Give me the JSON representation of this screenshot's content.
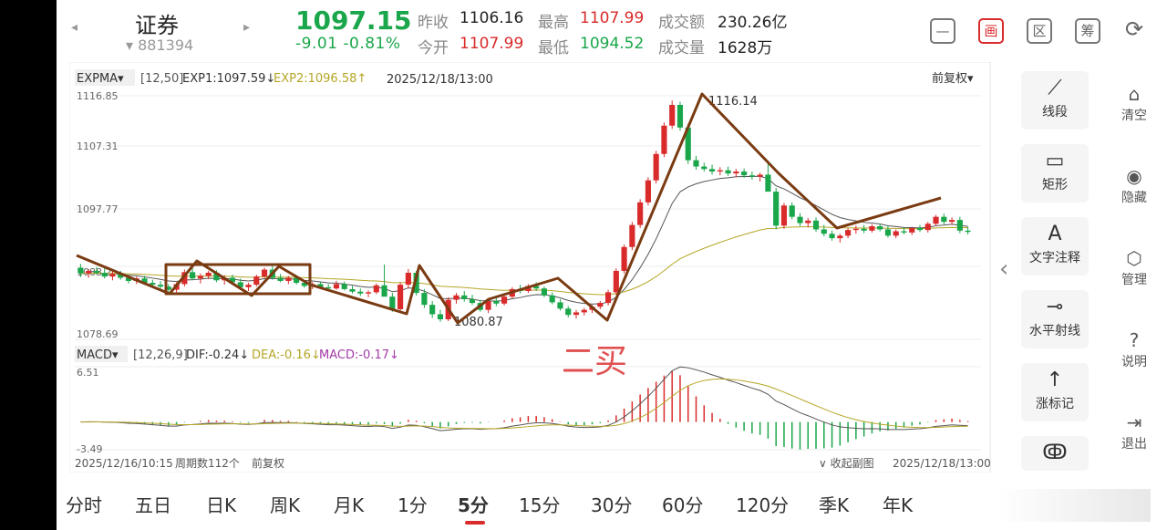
{
  "header": {
    "prev_label": "◂",
    "next_label": "▸",
    "title": "证券",
    "code": "▾ 881394",
    "price": "1097.15",
    "change": "-9.01  -0.81%",
    "stats": [
      {
        "label": "昨收",
        "value": "1106.16"
      },
      {
        "label": "今开",
        "value": "1107.99"
      },
      {
        "label": "最高",
        "value": "1107.99"
      },
      {
        "label": "最低",
        "value": "1094.52"
      },
      {
        "label": "成交额",
        "value": "230.26亿"
      },
      {
        "label": "成交量",
        "value": "1628万"
      }
    ],
    "tool_icons": [
      "minus-box-icon",
      "draw-icon",
      "zone-icon",
      "chip-icon",
      "rotate-screen-icon"
    ],
    "tool_glyphs": [
      "—",
      "画",
      "区",
      "筹",
      "⟳"
    ]
  },
  "chart": {
    "indicator_name": "EXPMA▾",
    "params": "[12,50]",
    "exp1": "EXP1:1097.59↓",
    "exp2": "EXP2:1096.58↑",
    "datetime": "2025/12/18/13:00",
    "adjust": "前复权▾",
    "price_labels": [
      "1116.85",
      "1107.31",
      "1097.77",
      "1088.2",
      "1078.69"
    ],
    "high_annotation": "1116.14",
    "low_annotation": "1080.87",
    "annotation_text": "二买",
    "macd_name": "MACD▾",
    "macd_params": "[12,26,9]",
    "dif": "DIF:-0.24↓",
    "dea": "DEA:-0.16↓",
    "macd": "MACD:-0.17↓",
    "macd_top": "6.51",
    "macd_bottom": "-3.49",
    "start_date": "2025/12/16/10:15",
    "period_count": "周期数112个",
    "adjust_small": "前复权",
    "collapse_label": "∨ 收起副图",
    "end_date": "2025/12/18/13:00"
  },
  "colors": {
    "up": "#d92b2b",
    "down": "#1aa64a",
    "exp1_line": "#555555",
    "exp2_line": "#b5a626",
    "draw_line": "#7a3b12",
    "macd_purple": "#a23aa8"
  },
  "tool_panel": [
    {
      "icon": "segment-icon",
      "glyph": "⟋",
      "label": "线段"
    },
    {
      "icon": "rectangle-icon",
      "glyph": "▭",
      "label": "矩形"
    },
    {
      "icon": "text-annotation-icon",
      "glyph": "A",
      "label": "文字注释"
    },
    {
      "icon": "horizontal-ray-icon",
      "glyph": "⊸",
      "label": "水平射线"
    },
    {
      "icon": "rise-marker-icon",
      "glyph": "↑",
      "label": "涨标记"
    },
    {
      "icon": "wave-icon",
      "glyph": "ↂ",
      "label": ""
    }
  ],
  "right_column": [
    {
      "icon": "clear-icon",
      "glyph": "⌂",
      "label": "清空"
    },
    {
      "icon": "eye-icon",
      "glyph": "◉",
      "label": "隐藏"
    },
    {
      "icon": "gear-icon",
      "glyph": "⬡",
      "label": "管理"
    },
    {
      "icon": "help-icon",
      "glyph": "?",
      "label": "说明"
    },
    {
      "icon": "exit-icon",
      "glyph": "⇥",
      "label": "退出"
    }
  ],
  "collapse_arrow": "‹",
  "tabs": [
    "分时",
    "五日",
    "日K",
    "周K",
    "月K",
    "1分",
    "5分",
    "15分",
    "30分",
    "60分",
    "120分",
    "季K",
    "年K"
  ],
  "active_tab": "5分",
  "tabs_more_icon": "more-icon",
  "chart_data": {
    "type": "candlestick",
    "ylim": [
      1078.69,
      1116.85
    ],
    "candles": [
      [
        1089.5,
        1090.1,
        1088.0,
        1088.6
      ],
      [
        1088.6,
        1089.3,
        1087.9,
        1089.0
      ],
      [
        1089.0,
        1089.6,
        1088.4,
        1088.7
      ],
      [
        1088.7,
        1089.5,
        1087.8,
        1088.1
      ],
      [
        1088.1,
        1088.9,
        1087.5,
        1088.5
      ],
      [
        1088.5,
        1089.0,
        1087.6,
        1087.9
      ],
      [
        1087.9,
        1088.3,
        1087.0,
        1087.4
      ],
      [
        1087.4,
        1088.1,
        1086.9,
        1087.8
      ],
      [
        1087.8,
        1088.2,
        1086.8,
        1087.1
      ],
      [
        1087.1,
        1087.6,
        1086.4,
        1086.8
      ],
      [
        1086.8,
        1087.4,
        1086.2,
        1086.5
      ],
      [
        1086.5,
        1086.9,
        1085.7,
        1086.0
      ],
      [
        1086.0,
        1087.2,
        1085.6,
        1086.9
      ],
      [
        1086.9,
        1089.2,
        1086.5,
        1088.8
      ],
      [
        1088.8,
        1089.4,
        1087.5,
        1087.8
      ],
      [
        1087.8,
        1088.6,
        1087.0,
        1088.2
      ],
      [
        1088.2,
        1089.0,
        1087.7,
        1088.7
      ],
      [
        1088.7,
        1089.1,
        1087.2,
        1087.5
      ],
      [
        1087.5,
        1088.3,
        1086.8,
        1087.9
      ],
      [
        1087.9,
        1088.4,
        1086.9,
        1087.2
      ],
      [
        1087.2,
        1087.8,
        1086.1,
        1086.4
      ],
      [
        1086.4,
        1087.1,
        1085.8,
        1086.8
      ],
      [
        1086.8,
        1088.4,
        1086.5,
        1088.1
      ],
      [
        1088.1,
        1089.5,
        1087.9,
        1089.2
      ],
      [
        1089.2,
        1089.8,
        1087.6,
        1087.9
      ],
      [
        1087.9,
        1088.5,
        1087.2,
        1087.4
      ],
      [
        1087.4,
        1088.2,
        1086.9,
        1087.9
      ],
      [
        1087.9,
        1088.3,
        1086.8,
        1087.1
      ],
      [
        1087.1,
        1087.5,
        1086.3,
        1086.6
      ],
      [
        1086.6,
        1087.2,
        1086.1,
        1086.9
      ],
      [
        1086.9,
        1087.3,
        1086.2,
        1086.4
      ],
      [
        1086.4,
        1086.9,
        1085.9,
        1086.2
      ],
      [
        1086.2,
        1087.4,
        1086.0,
        1086.9
      ],
      [
        1086.9,
        1087.3,
        1085.9,
        1086.1
      ],
      [
        1086.1,
        1086.6,
        1085.4,
        1085.7
      ],
      [
        1085.7,
        1086.2,
        1085.0,
        1085.4
      ],
      [
        1085.4,
        1085.9,
        1084.8,
        1085.6
      ],
      [
        1085.6,
        1087.0,
        1085.3,
        1086.7
      ],
      [
        1086.7,
        1090.0,
        1085.5,
        1084.9
      ],
      [
        1084.9,
        1085.5,
        1082.5,
        1082.9
      ],
      [
        1082.9,
        1087.2,
        1082.5,
        1086.8
      ],
      [
        1086.8,
        1089.3,
        1086.2,
        1088.7
      ],
      [
        1088.7,
        1089.0,
        1085.1,
        1085.5
      ],
      [
        1085.5,
        1086.1,
        1083.1,
        1083.6
      ],
      [
        1083.6,
        1084.2,
        1081.5,
        1082.1
      ],
      [
        1082.1,
        1082.8,
        1080.9,
        1081.3
      ],
      [
        1081.3,
        1084.8,
        1081.0,
        1084.4
      ],
      [
        1084.4,
        1085.5,
        1083.8,
        1085.1
      ],
      [
        1085.1,
        1085.8,
        1084.1,
        1084.5
      ],
      [
        1084.5,
        1085.2,
        1083.6,
        1083.9
      ],
      [
        1083.9,
        1084.4,
        1082.5,
        1082.8
      ],
      [
        1082.8,
        1084.6,
        1082.3,
        1084.2
      ],
      [
        1084.2,
        1084.9,
        1083.4,
        1083.8
      ],
      [
        1083.8,
        1085.2,
        1083.5,
        1084.9
      ],
      [
        1084.9,
        1086.4,
        1084.6,
        1086.1
      ],
      [
        1086.1,
        1086.8,
        1085.4,
        1085.8
      ],
      [
        1085.8,
        1086.9,
        1085.5,
        1086.6
      ],
      [
        1086.6,
        1087.2,
        1085.8,
        1086.2
      ],
      [
        1086.2,
        1086.5,
        1084.8,
        1085.1
      ],
      [
        1085.1,
        1085.6,
        1083.7,
        1084.0
      ],
      [
        1084.0,
        1084.5,
        1082.7,
        1083.0
      ],
      [
        1083.0,
        1083.4,
        1081.6,
        1082.0
      ],
      [
        1082.0,
        1082.8,
        1081.4,
        1082.4
      ],
      [
        1082.4,
        1083.1,
        1081.9,
        1082.8
      ],
      [
        1082.8,
        1083.6,
        1082.3,
        1083.3
      ],
      [
        1083.3,
        1084.2,
        1082.9,
        1083.9
      ],
      [
        1083.9,
        1086.0,
        1083.5,
        1085.6
      ],
      [
        1085.6,
        1089.4,
        1085.2,
        1089.0
      ],
      [
        1089.0,
        1093.2,
        1088.6,
        1092.8
      ],
      [
        1092.8,
        1096.8,
        1092.3,
        1096.3
      ],
      [
        1096.3,
        1100.4,
        1095.8,
        1099.9
      ],
      [
        1099.9,
        1103.9,
        1099.4,
        1103.4
      ],
      [
        1103.4,
        1108.1,
        1102.9,
        1107.6
      ],
      [
        1107.6,
        1112.6,
        1107.1,
        1112.1
      ],
      [
        1112.1,
        1116.1,
        1111.6,
        1115.4
      ],
      [
        1115.4,
        1115.9,
        1111.3,
        1111.8
      ],
      [
        1111.8,
        1112.4,
        1106.0,
        1106.6
      ],
      [
        1106.6,
        1107.3,
        1105.1,
        1105.6
      ],
      [
        1105.6,
        1106.2,
        1104.8,
        1105.2
      ],
      [
        1105.2,
        1105.9,
        1104.3,
        1104.8
      ],
      [
        1104.8,
        1105.5,
        1104.2,
        1105.0
      ],
      [
        1105.0,
        1105.6,
        1104.1,
        1104.5
      ],
      [
        1104.5,
        1105.2,
        1103.9,
        1104.8
      ],
      [
        1104.8,
        1105.3,
        1103.8,
        1104.2
      ],
      [
        1104.2,
        1104.8,
        1103.5,
        1104.0
      ],
      [
        1104.0,
        1104.6,
        1103.2,
        1104.3
      ],
      [
        1104.3,
        1106.2,
        1104.0,
        1101.6
      ],
      [
        1101.6,
        1102.2,
        1095.6,
        1096.2
      ],
      [
        1096.2,
        1099.8,
        1095.7,
        1099.4
      ],
      [
        1099.4,
        1099.9,
        1097.2,
        1097.6
      ],
      [
        1097.6,
        1098.2,
        1096.1,
        1096.6
      ],
      [
        1096.6,
        1097.4,
        1095.9,
        1097.0
      ],
      [
        1097.0,
        1097.5,
        1095.2,
        1095.6
      ],
      [
        1095.6,
        1096.3,
        1094.5,
        1094.9
      ],
      [
        1094.9,
        1095.4,
        1093.8,
        1094.2
      ],
      [
        1094.2,
        1094.9,
        1093.5,
        1094.6
      ],
      [
        1094.6,
        1095.8,
        1094.2,
        1095.5
      ],
      [
        1095.5,
        1096.2,
        1094.9,
        1095.7
      ],
      [
        1095.7,
        1096.3,
        1095.0,
        1095.4
      ],
      [
        1095.4,
        1096.4,
        1095.1,
        1096.1
      ],
      [
        1096.1,
        1096.5,
        1095.3,
        1095.6
      ],
      [
        1095.6,
        1096.2,
        1094.3,
        1094.6
      ],
      [
        1094.6,
        1095.6,
        1094.2,
        1095.3
      ],
      [
        1095.3,
        1095.9,
        1094.8,
        1095.1
      ],
      [
        1095.1,
        1096.0,
        1094.7,
        1095.8
      ],
      [
        1095.8,
        1096.3,
        1095.2,
        1095.5
      ],
      [
        1095.5,
        1096.8,
        1095.1,
        1096.5
      ],
      [
        1096.5,
        1097.9,
        1096.2,
        1097.6
      ],
      [
        1097.6,
        1098.1,
        1096.4,
        1096.8
      ],
      [
        1096.8,
        1097.5,
        1096.3,
        1097.1
      ],
      [
        1097.1,
        1097.6,
        1095.0,
        1095.4
      ],
      [
        1095.4,
        1096.0,
        1094.8,
        1095.2
      ]
    ]
  }
}
